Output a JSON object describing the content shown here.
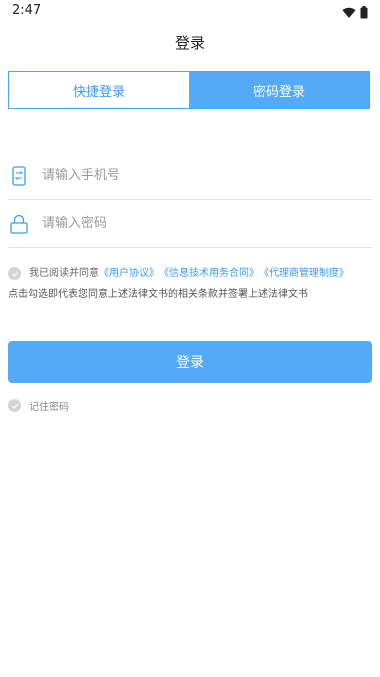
{
  "status_bar": {
    "time": "2:47",
    "icons": [
      "wifi-icon",
      "battery-icon"
    ]
  },
  "header": {
    "title": "登录"
  },
  "tabs": [
    {
      "label": "快捷登录",
      "active": false
    },
    {
      "label": "密码登录",
      "active": true
    }
  ],
  "form": {
    "phone_placeholder": "请输入手机号",
    "password_placeholder": "请输入密码"
  },
  "agreement": {
    "prefix": "我已阅读并同意",
    "link1": "《用户协议》",
    "link2": "《信息技术用务合同》",
    "link3": "《代理商管理制度》",
    "note": "点击勾选即代表您同意上述法律文书的相关条款并签署上述法律文书"
  },
  "login_button": "登录",
  "remember_label": "记住密码",
  "colors": {
    "accent": "#55aaf7",
    "link": "#3a9cf0",
    "check": "#d4d4d4"
  }
}
